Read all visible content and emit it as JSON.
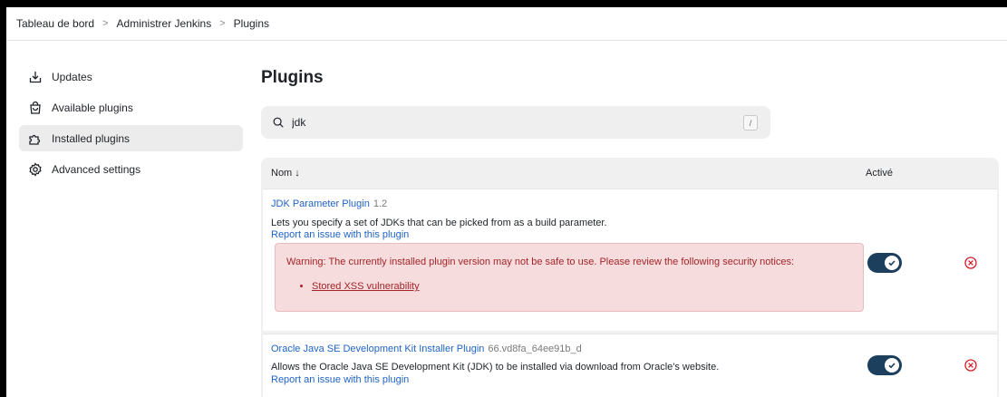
{
  "breadcrumb": [
    "Tableau de bord",
    "Administrer Jenkins",
    "Plugins"
  ],
  "sidebar": {
    "items": [
      {
        "label": "Updates",
        "icon": "download-icon"
      },
      {
        "label": "Available plugins",
        "icon": "shopping-bag-icon"
      },
      {
        "label": "Installed plugins",
        "icon": "puzzle-icon",
        "active": true
      },
      {
        "label": "Advanced settings",
        "icon": "gear-icon"
      }
    ]
  },
  "main": {
    "title": "Plugins",
    "search": {
      "value": "jdk",
      "shortcut": "/"
    },
    "table": {
      "col_name": "Nom ↓",
      "col_enabled": "Activé",
      "rows": [
        {
          "name": "JDK Parameter Plugin",
          "version": "1.2",
          "description": "Lets you specify a set of JDKs that can be picked from as a build parameter.",
          "report": "Report an issue with this plugin",
          "warning": "Warning: The currently installed plugin version may not be safe to use. Please review the following security notices:",
          "warning_link": "Stored XSS vulnerability",
          "enabled": true
        },
        {
          "name": "Oracle Java SE Development Kit Installer Plugin",
          "version": "66.vd8fa_64ee91b_d",
          "description": "Allows the Oracle Java SE Development Kit (JDK) to be installed via download from Oracle's website.",
          "report": "Report an issue with this plugin",
          "enabled": true
        }
      ]
    }
  },
  "colors": {
    "link": "#1f63c6",
    "toggle_on": "#1d3f5e",
    "danger": "#d11f2a",
    "warning_bg": "#f6dcdc"
  }
}
